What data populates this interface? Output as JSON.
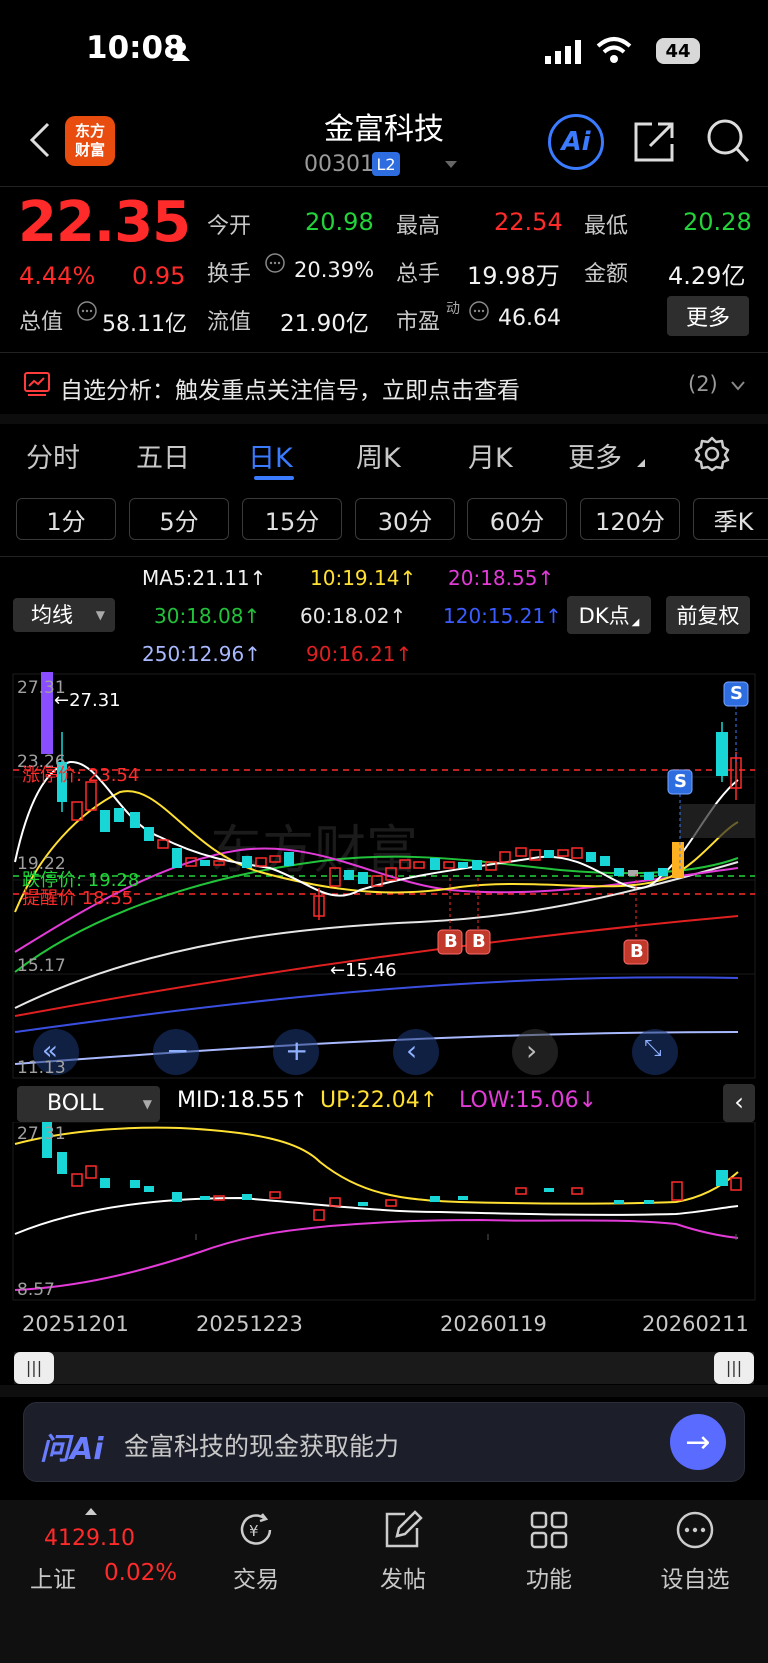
{
  "status_bar": {
    "time": "10:08",
    "battery": "44"
  },
  "header": {
    "logo": "东方\n财富",
    "name": "金富科技",
    "code": "003018",
    "level": "L2",
    "ai_label": "Ai"
  },
  "quote": {
    "price": "22.35",
    "change_pct": "4.44%",
    "change": "0.95",
    "open_label": "今开",
    "open": "20.98",
    "high_label": "最高",
    "high": "22.54",
    "low_label": "最低",
    "low": "20.28",
    "turnover_label": "换手",
    "turnover": "20.39%",
    "volume_label": "总手",
    "volume": "19.98万",
    "amount_label": "金额",
    "amount": "4.29亿",
    "mktcap_label": "总值",
    "mktcap": "58.11亿",
    "float_label": "流值",
    "float_cap": "21.90亿",
    "pe_label": "市盈",
    "pe_sup": "动",
    "pe": "46.64",
    "more": "更多"
  },
  "alert": {
    "text": "自选分析：触发重点关注信号，立即点击查看",
    "count": "(2)"
  },
  "tabs": [
    "分时",
    "五日",
    "日K",
    "周K",
    "月K",
    "更多"
  ],
  "periods": [
    "1分",
    "5分",
    "15分",
    "30分",
    "60分",
    "120分",
    "季K"
  ],
  "ma": {
    "selector": "均线",
    "ma5": "MA5:21.11↑",
    "ma10": "10:19.14↑",
    "ma20": "20:18.55↑",
    "ma30": "30:18.08↑",
    "ma60": "60:18.02↑",
    "ma120": "120:15.21↑",
    "ma250": "250:12.96↑",
    "ma90": "90:16.21↑",
    "dk": "DK点",
    "adjust": "前复权"
  },
  "main_chart": {
    "y_top": "27.31",
    "y2": "23.26",
    "y3": "19.22",
    "y4": "15.17",
    "y_bottom": "11.13",
    "max_label": "←27.31",
    "min_label": "←15.46",
    "limit_up": "涨停价: 23.54",
    "limit_down": "跌停价: 19.28",
    "alert_price": "提醒价 18.55",
    "buy": "B",
    "sell": "S",
    "colors": {
      "up": "#ff2a2a",
      "down": "#18d6d6",
      "ma5": "#ffffff",
      "ma10": "#ffe033",
      "ma20": "#e23bd8",
      "ma30": "#22c23a",
      "ma60": "#e6e6e6",
      "ma90": "#e02020",
      "ma120": "#3a4fe0",
      "ma250": "#a9b9ff"
    }
  },
  "boll": {
    "selector": "BOLL",
    "mid": "MID:18.55↑",
    "up": "UP:22.04↑",
    "low": "LOW:15.06↓",
    "y_top": "27.31",
    "y_bottom": "8.57"
  },
  "dates": [
    "20251201",
    "20251223",
    "20260119",
    "20260211"
  ],
  "ai_bar": {
    "logo": "问Ai",
    "text": "金富科技的现金获取能力"
  },
  "bottom_nav": {
    "index_value": "4129.10",
    "index_name": "上证",
    "index_change": "0.02%",
    "items": [
      "交易",
      "发帖",
      "功能",
      "设自选"
    ]
  }
}
